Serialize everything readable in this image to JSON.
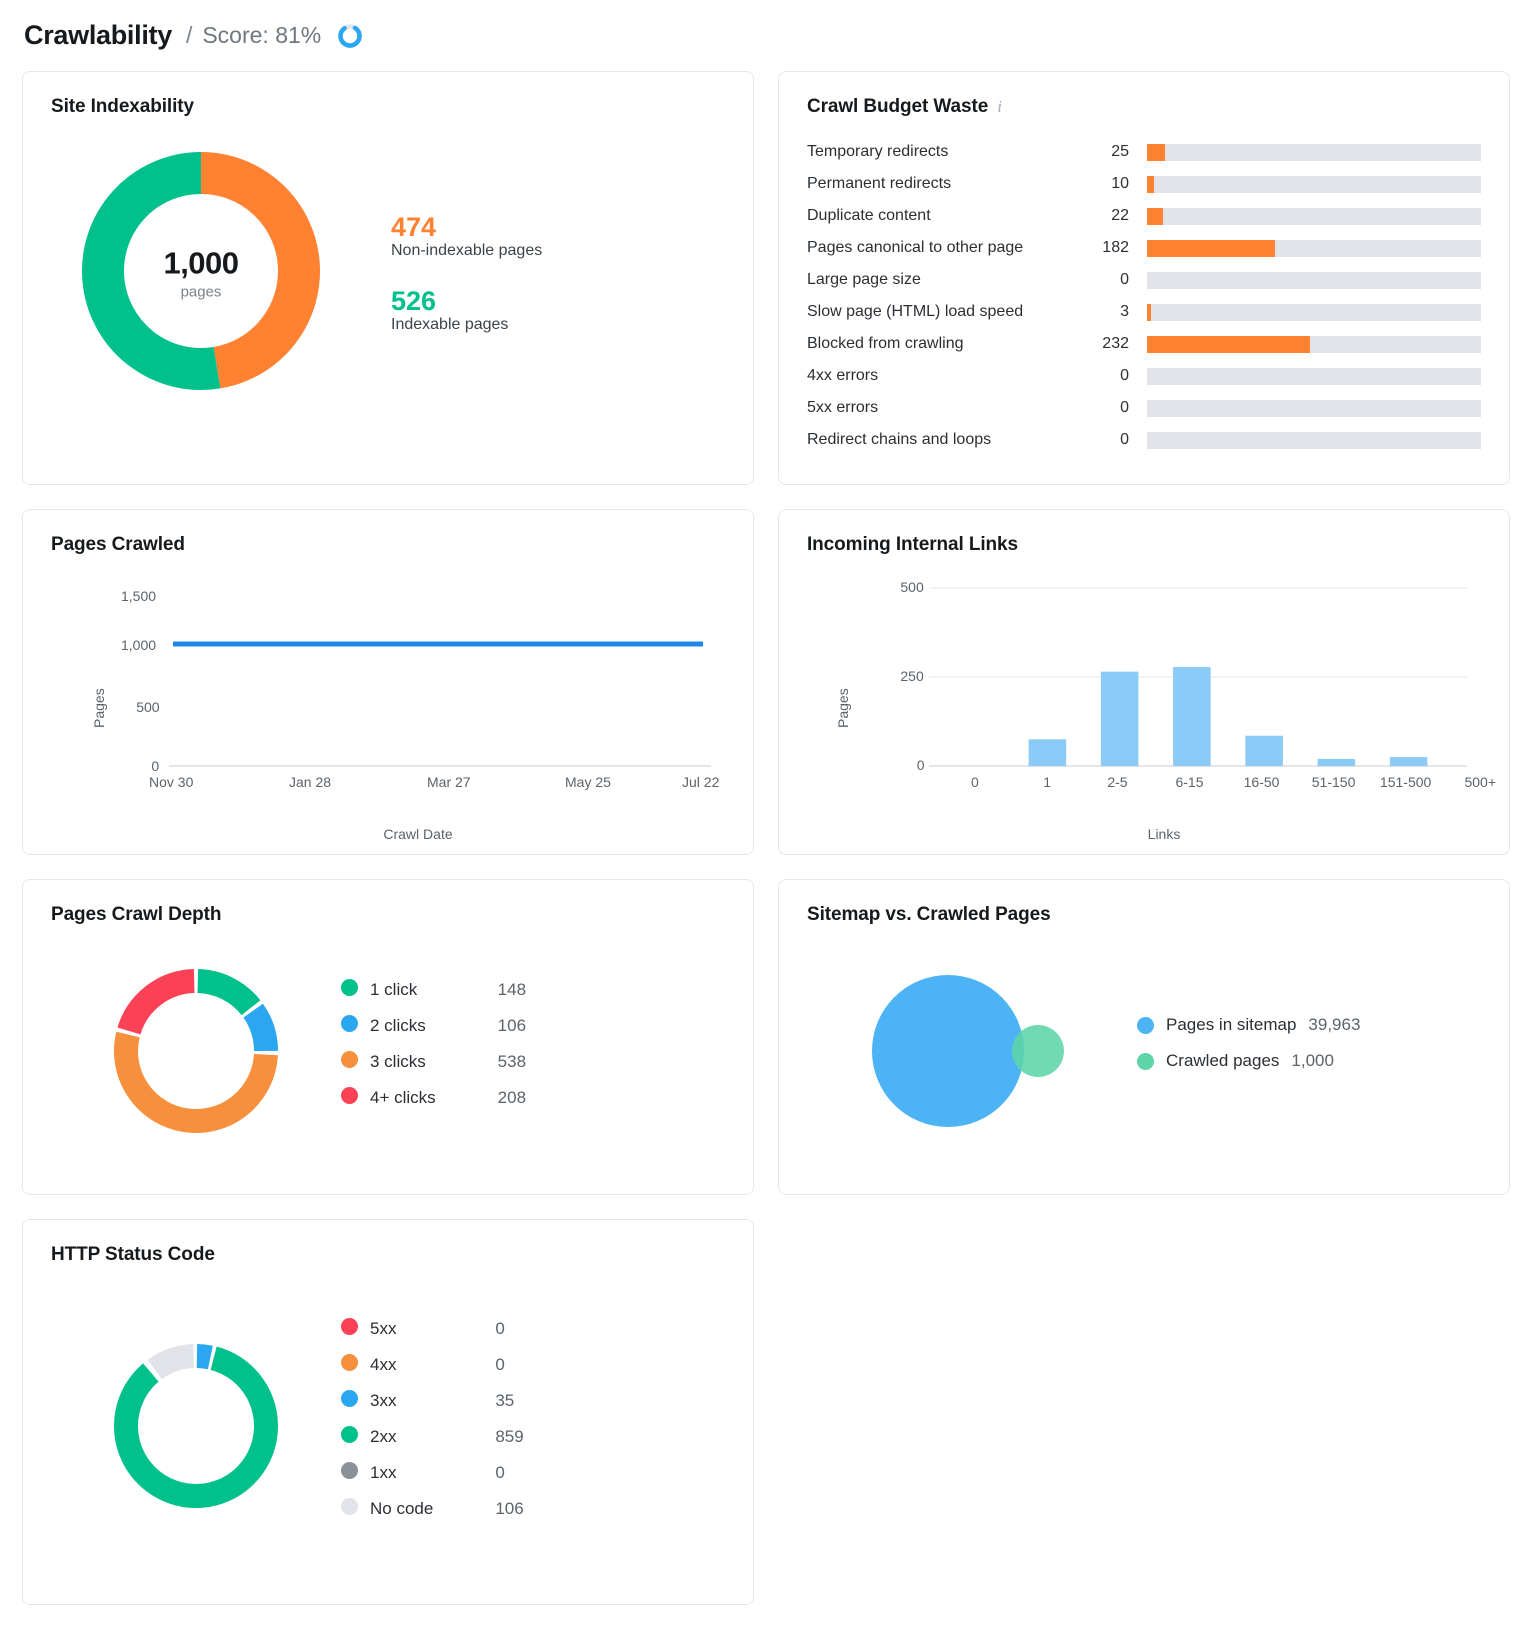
{
  "header": {
    "title": "Crawlability",
    "separator": "/",
    "score_label": "Score: 81%",
    "score_percent": 81,
    "ring_icon": "score-ring-icon"
  },
  "colors": {
    "green": "#00c08b",
    "orange": "#ff8132",
    "blue": "#2aa7f0",
    "light_blue": "#8ccaf7",
    "red": "#fa4155",
    "gray": "#8b9199",
    "light_gray": "#e1e3e9",
    "track": "#e1e3e9"
  },
  "cards": {
    "site_indexability": {
      "title": "Site Indexability",
      "center_value": "1,000",
      "center_label": "pages",
      "total": 1000,
      "items": [
        {
          "value": "474",
          "label": "Non-indexable pages",
          "number": 474,
          "color": "#ff8132"
        },
        {
          "value": "526",
          "label": "Indexable pages",
          "number": 526,
          "color": "#00c08b"
        }
      ]
    },
    "crawl_budget_waste": {
      "title": "Crawl Budget Waste",
      "info_icon": "info-icon",
      "max_value": 474,
      "rows": [
        {
          "label": "Temporary redirects",
          "value": "25",
          "number": 25
        },
        {
          "label": "Permanent redirects",
          "value": "10",
          "number": 10
        },
        {
          "label": "Duplicate content",
          "value": "22",
          "number": 22
        },
        {
          "label": "Pages canonical to other page",
          "value": "182",
          "number": 182
        },
        {
          "label": "Large page size",
          "value": "0",
          "number": 0
        },
        {
          "label": "Slow page (HTML) load speed",
          "value": "3",
          "number": 3
        },
        {
          "label": "Blocked from crawling",
          "value": "232",
          "number": 232
        },
        {
          "label": "4xx errors",
          "value": "0",
          "number": 0
        },
        {
          "label": "5xx errors",
          "value": "0",
          "number": 0
        },
        {
          "label": "Redirect chains and loops",
          "value": "0",
          "number": 0
        }
      ]
    },
    "pages_crawled": {
      "title": "Pages Crawled"
    },
    "incoming_internal_links": {
      "title": "Incoming Internal Links"
    },
    "pages_crawl_depth": {
      "title": "Pages Crawl Depth",
      "legend": [
        {
          "label": "1 click",
          "value": "148",
          "number": 148,
          "color": "#00c08b"
        },
        {
          "label": "2 clicks",
          "value": "106",
          "number": 106,
          "color": "#2aa7f0"
        },
        {
          "label": "3 clicks",
          "value": "538",
          "number": 538,
          "color": "#f7903c"
        },
        {
          "label": "4+ clicks",
          "value": "208",
          "number": 208,
          "color": "#fa4155"
        }
      ]
    },
    "sitemap_vs_crawled": {
      "title": "Sitemap vs. Crawled Pages",
      "legend": [
        {
          "label": "Pages in sitemap",
          "value": "39,963",
          "number": 39963,
          "color": "#4cb3f5"
        },
        {
          "label": "Crawled pages",
          "value": "1,000",
          "number": 1000,
          "color": "#5ed5a8"
        }
      ]
    },
    "http_status_code": {
      "title": "HTTP Status Code",
      "legend": [
        {
          "label": "5xx",
          "value": "0",
          "number": 0,
          "color": "#fa4155"
        },
        {
          "label": "4xx",
          "value": "0",
          "number": 0,
          "color": "#f7903c"
        },
        {
          "label": "3xx",
          "value": "35",
          "number": 35,
          "color": "#2aa7f0"
        },
        {
          "label": "2xx",
          "value": "859",
          "number": 859,
          "color": "#00c08b"
        },
        {
          "label": "1xx",
          "value": "0",
          "number": 0,
          "color": "#8b9199"
        },
        {
          "label": "No code",
          "value": "106",
          "number": 106,
          "color": "#e1e3e9"
        }
      ]
    }
  },
  "chart_data": [
    {
      "id": "pages_crawled",
      "type": "line",
      "title": "Pages Crawled",
      "xlabel": "Crawl Date",
      "ylabel": "Pages",
      "yticks": [
        "0",
        "500",
        "1,000",
        "1,500"
      ],
      "ylim": [
        0,
        1500
      ],
      "xticks": [
        "Nov 30",
        "Jan 28",
        "Mar 27",
        "May 25",
        "Jul 22"
      ],
      "series": [
        {
          "name": "Pages",
          "color": "#2089e8",
          "values": [
            1000,
            1000,
            1000,
            1000,
            1000
          ]
        }
      ],
      "grid": false,
      "legend": "none"
    },
    {
      "id": "incoming_internal_links",
      "type": "bar",
      "title": "Incoming Internal Links",
      "xlabel": "Links",
      "ylabel": "Pages",
      "yticks": [
        "0",
        "250",
        "500"
      ],
      "ylim": [
        0,
        500
      ],
      "categories": [
        "0",
        "1",
        "2-5",
        "6-15",
        "16-50",
        "51-150",
        "151-500",
        "500+"
      ],
      "values": [
        0,
        75,
        265,
        278,
        85,
        20,
        25,
        0
      ],
      "color": "#8ccaf7",
      "grid": true,
      "legend": "none"
    },
    {
      "id": "site_indexability",
      "type": "pie",
      "title": "Site Indexability",
      "labels": [
        "Indexable pages",
        "Non-indexable pages"
      ],
      "values": [
        526,
        474
      ],
      "colors": [
        "#00c08b",
        "#ff8132"
      ],
      "center_value": "1,000",
      "center_label": "pages",
      "legend": "right"
    },
    {
      "id": "pages_crawl_depth",
      "type": "pie",
      "title": "Pages Crawl Depth",
      "labels": [
        "1 click",
        "2 clicks",
        "3 clicks",
        "4+ clicks"
      ],
      "values": [
        148,
        106,
        538,
        208
      ],
      "colors": [
        "#00c08b",
        "#2aa7f0",
        "#f7903c",
        "#fa4155"
      ],
      "legend": "right"
    },
    {
      "id": "http_status_code",
      "type": "pie",
      "title": "HTTP Status Code",
      "labels": [
        "5xx",
        "4xx",
        "3xx",
        "2xx",
        "1xx",
        "No code"
      ],
      "values": [
        0,
        0,
        35,
        859,
        0,
        106
      ],
      "colors": [
        "#fa4155",
        "#f7903c",
        "#2aa7f0",
        "#00c08b",
        "#8b9199",
        "#e1e3e9"
      ],
      "legend": "right"
    },
    {
      "id": "sitemap_vs_crawled",
      "type": "scatter",
      "title": "Sitemap vs. Crawled Pages",
      "labels": [
        "Pages in sitemap",
        "Crawled pages"
      ],
      "values": [
        39963,
        1000
      ],
      "colors": [
        "#4cb3f5",
        "#5ed5a8"
      ],
      "legend": "right"
    }
  ]
}
